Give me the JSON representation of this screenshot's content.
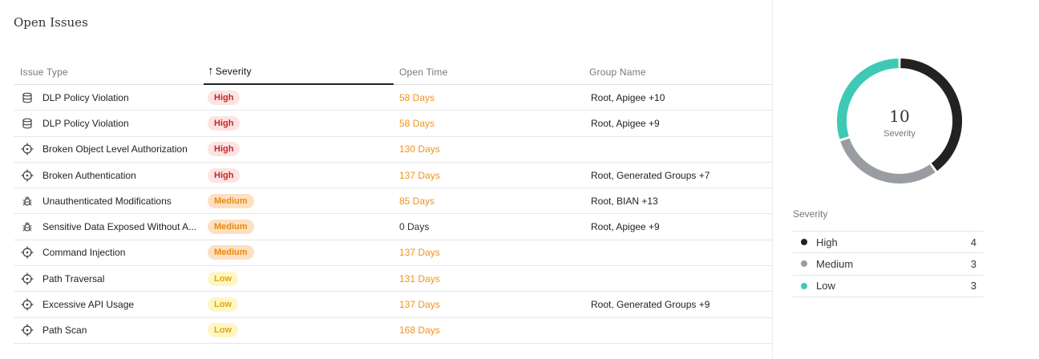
{
  "panel": {
    "title": "Open Issues"
  },
  "table": {
    "headers": [
      "Issue Type",
      "Severity",
      "Open Time",
      "Group Name"
    ],
    "sort_icon": "arrow-up-icon",
    "rows": [
      {
        "icon": "database-icon",
        "issue": "DLP Policy Violation",
        "severity": "High",
        "level": "high",
        "open_time": "58 Days",
        "time_color": "orange",
        "group": "Root, Apigee +10"
      },
      {
        "icon": "database-icon",
        "issue": "DLP Policy Violation",
        "severity": "High",
        "level": "high",
        "open_time": "58 Days",
        "time_color": "orange",
        "group": "Root, Apigee +9"
      },
      {
        "icon": "crosshair-icon",
        "issue": "Broken Object Level Authorization",
        "severity": "High",
        "level": "high",
        "open_time": "130 Days",
        "time_color": "orange",
        "group": ""
      },
      {
        "icon": "crosshair-icon",
        "issue": "Broken Authentication",
        "severity": "High",
        "level": "high",
        "open_time": "137 Days",
        "time_color": "orange",
        "group": "Root, Generated Groups +7"
      },
      {
        "icon": "bug-icon",
        "issue": "Unauthenticated Modifications",
        "severity": "Medium",
        "level": "medium",
        "open_time": "85 Days",
        "time_color": "orange",
        "group": "Root, BIAN +13"
      },
      {
        "icon": "bug-icon",
        "issue": "Sensitive Data Exposed Without A...",
        "severity": "Medium",
        "level": "medium",
        "open_time": "0 Days",
        "time_color": "gray",
        "group": "Root, Apigee +9"
      },
      {
        "icon": "crosshair-icon",
        "issue": "Command Injection",
        "severity": "Medium",
        "level": "medium",
        "open_time": "137 Days",
        "time_color": "orange",
        "group": ""
      },
      {
        "icon": "crosshair-icon",
        "issue": "Path Traversal",
        "severity": "Low",
        "level": "low",
        "open_time": "131 Days",
        "time_color": "orange",
        "group": ""
      },
      {
        "icon": "crosshair-icon",
        "issue": "Excessive API Usage",
        "severity": "Low",
        "level": "low",
        "open_time": "137 Days",
        "time_color": "orange",
        "group": "Root, Generated Groups +9"
      },
      {
        "icon": "crosshair-icon",
        "issue": "Path Scan",
        "severity": "Low",
        "level": "low",
        "open_time": "168 Days",
        "time_color": "orange",
        "group": ""
      }
    ]
  },
  "summary": {
    "total": "10",
    "total_label": "Severity",
    "legend_title": "Severity",
    "items": [
      {
        "name": "High",
        "count": 4,
        "color": "#222222"
      },
      {
        "name": "Medium",
        "count": 3,
        "color": "#999da1"
      },
      {
        "name": "Low",
        "count": 3,
        "color": "#3fc9b4"
      }
    ]
  }
}
